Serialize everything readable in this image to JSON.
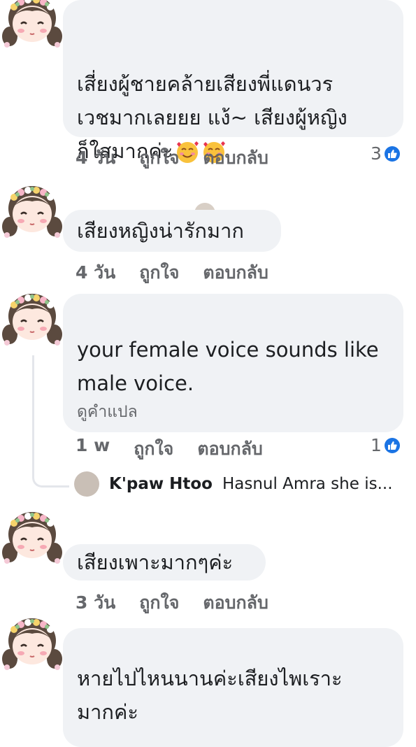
{
  "comments": [
    {
      "text": "เสี่ยงผู้ชายคล้ายเสียงพี่แดนวร\nเวชมากเลยยย แง้~ เสียงผู้หญิง\nก็ใสมากค่ะ",
      "emoji_icon": "smiling-face-with-hearts-icon",
      "time": "4 วัน",
      "like_label": "ถูกใจ",
      "reply_label": "ตอบกลับ",
      "reaction_count": "3"
    },
    {
      "text": "เสียงหญิงน่ารักมาก",
      "time": "4 วัน",
      "like_label": "ถูกใจ",
      "reply_label": "ตอบกลับ"
    },
    {
      "text": "your female voice sounds like\nmale voice.",
      "translate_label": "ดูคำแปล",
      "time": "1 w",
      "like_label": "ถูกใจ",
      "reply_label": "ตอบกลับ",
      "reaction_count": "1",
      "reply": {
        "name": "K'paw Htoo",
        "text": "Hasnul Amra she is..."
      }
    },
    {
      "text": "เสียงเพาะมากๆค่ะ",
      "time": "3 วัน",
      "like_label": "ถูกใจ",
      "reply_label": "ตอบกลับ"
    },
    {
      "text": "หายไปไหนนานค่ะเสียงไพเราะ\nมากค่ะ"
    }
  ],
  "colors": {
    "bubble": "#f0f2f5",
    "meta": "#65676b",
    "like_blue": "#1b74e4"
  }
}
